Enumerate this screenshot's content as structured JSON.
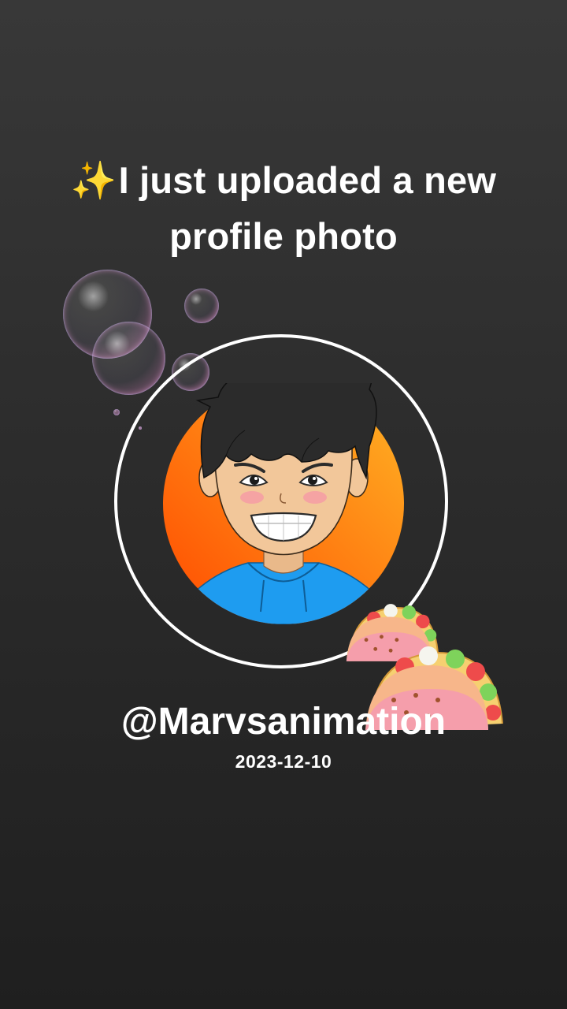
{
  "post": {
    "sparkle_emoji": "✨",
    "headline": "I just uploaded a new profile photo",
    "username": "@Marvsanimation",
    "date": "2023-12-10"
  },
  "colors": {
    "background_top": "#383838",
    "background_bottom": "#1f1f1f",
    "ring": "#ffffff",
    "avatar_gradient_start": "#ff5a00",
    "avatar_gradient_end": "#ffb020",
    "hoodie": "#1e9cf0",
    "hair": "#2b2b2b",
    "skin": "#f2c79a"
  },
  "decorations": {
    "bubbles_icon": "bubbles-icon",
    "taco_icon": "taco-icon"
  }
}
